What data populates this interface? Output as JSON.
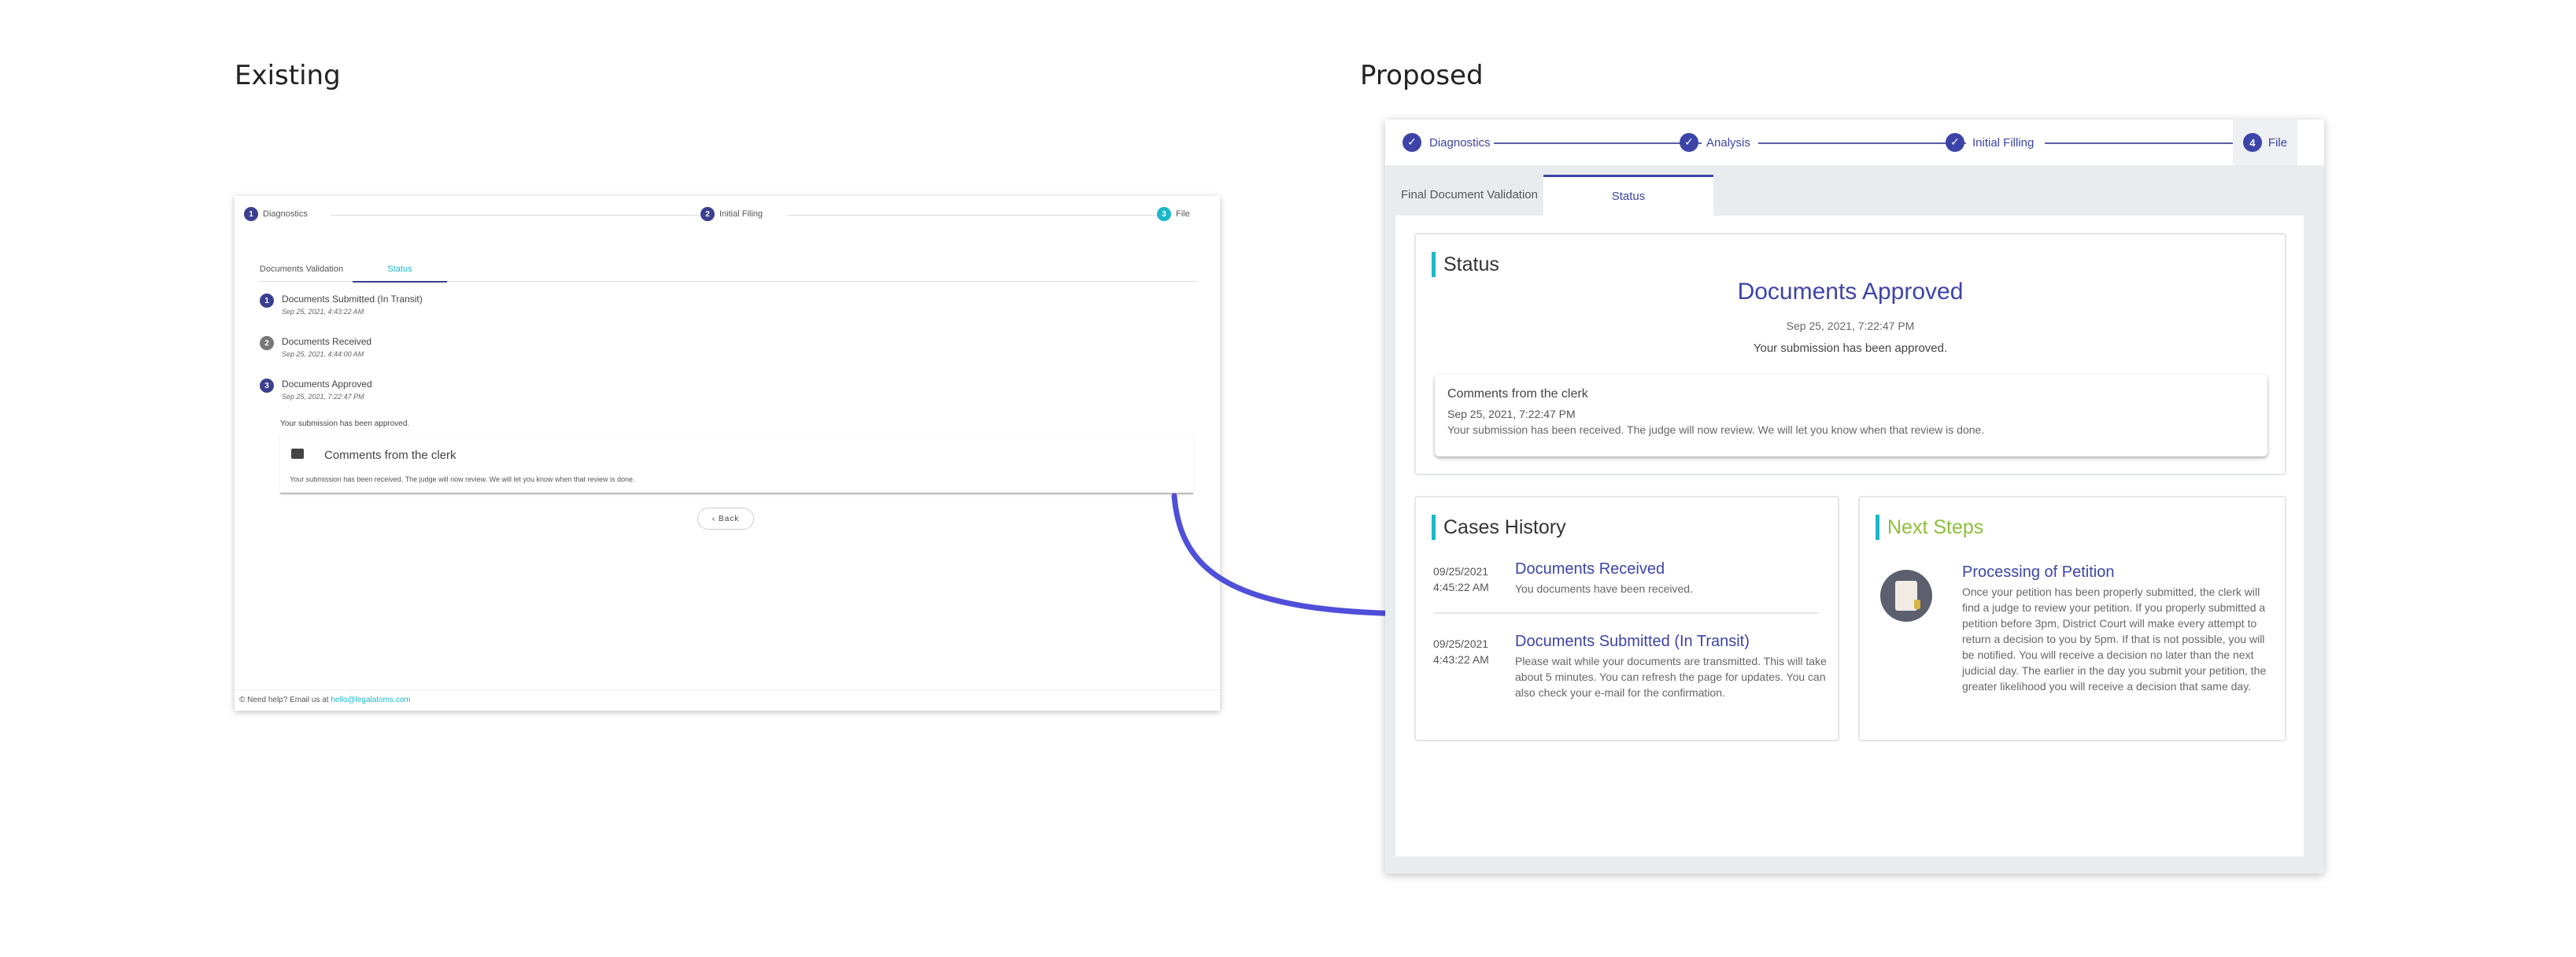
{
  "labels": {
    "existing": "Existing",
    "proposed": "Proposed"
  },
  "existing": {
    "steps": [
      {
        "num": "1",
        "label": "Diagnostics"
      },
      {
        "num": "2",
        "label": "Initial Filing"
      },
      {
        "num": "3",
        "label": "File"
      }
    ],
    "tabs": [
      "Documents Validation",
      "Status"
    ],
    "timeline": [
      {
        "num": "1",
        "title": "Documents Submitted (In Transit)",
        "date": "Sep 25, 2021, 4:43:22 AM"
      },
      {
        "num": "2",
        "title": "Documents Received",
        "date": "Sep 25, 2021, 4:44:00 AM"
      },
      {
        "num": "3",
        "title": "Documents Approved",
        "date": "Sep 25, 2021, 7:22:47 PM"
      }
    ],
    "approved_note": "Your submission has been approved.",
    "comments": {
      "title": "Comments from the clerk",
      "text": "Your submission has been received. The judge will now review. We will let you know when that review is done."
    },
    "back_label": "Back",
    "footer": {
      "text": "© Need help? Email us at ",
      "email": "hello@legalatoms.com"
    }
  },
  "proposed": {
    "steps": [
      "Diagnostics",
      "Analysis",
      "Initial Filling"
    ],
    "file_step": {
      "num": "4",
      "label": "File"
    },
    "tabs": [
      "Final Document Validation",
      "Status"
    ],
    "status": {
      "title": "Status",
      "heading": "Documents Approved",
      "date": "Sep 25, 2021, 7:22:47 PM",
      "message": "Your submission has been approved.",
      "clerk": {
        "title": "Comments from the clerk",
        "date": "Sep 25, 2021, 7:22:47 PM",
        "message": "Your submission has been received. The judge will now review. We will let you know when that review is done."
      }
    },
    "history": {
      "title": "Cases History",
      "items": [
        {
          "date": "09/25/2021",
          "time": "4:45:22 AM",
          "title": "Documents Received",
          "desc": "You documents have been received."
        },
        {
          "date": "09/25/2021",
          "time": "4:43:22 AM",
          "title": "Documents Submitted (In Transit)",
          "desc": "Please wait while your documents are transmitted. This will take about 5 minutes. You can refresh the page for updates. You can also check your e-mail for the confirmation."
        }
      ]
    },
    "next_steps": {
      "title": "Next Steps",
      "item_title": "Processing of Petition",
      "text": "Once your petition has been properly submitted, the clerk will find a judge to review your petition. If you properly submitted a petition before 3pm, District Court will make every attempt to return a decision to you by 5pm. If that is not possible, you will be notified. You will receive a decision no later than the next judicial day. The earlier in the day you submit your petition, the greater likelihood you will receive a decision that same day.",
      "icon": "petition-scroll-icon"
    }
  },
  "colors": {
    "navy": "#3d44a8",
    "teal": "#1bb8c9",
    "green": "#8dbf3a",
    "arrow": "#4f4fd9"
  }
}
